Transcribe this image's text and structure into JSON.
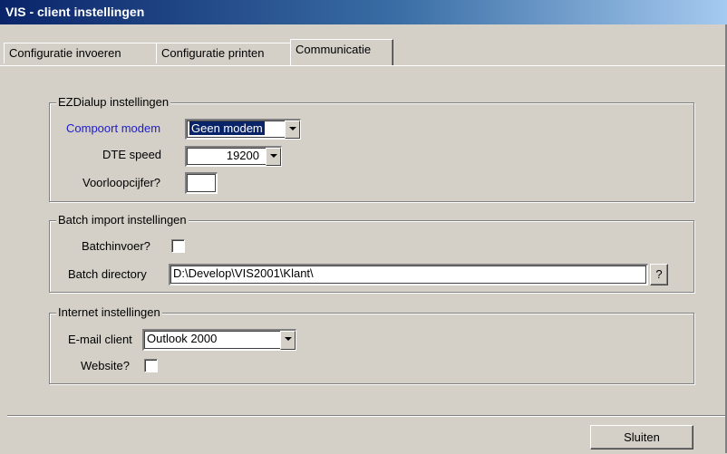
{
  "window": {
    "title": "VIS - client instellingen"
  },
  "tabs": [
    {
      "label": "Configuratie invoeren",
      "active": false
    },
    {
      "label": "Configuratie printen",
      "active": false
    },
    {
      "label": "Communicatie",
      "active": true
    }
  ],
  "ezdialup": {
    "title": "EZDialup instellingen",
    "compoort_label": "Compoort modem",
    "compoort_value": "Geen modem",
    "dte_label": "DTE speed",
    "dte_value": "19200",
    "voorloop_label": "Voorloopcijfer?",
    "voorloop_value": ""
  },
  "batch": {
    "title": "Batch import instellingen",
    "batchinvoer_label": "Batchinvoer?",
    "batchinvoer_checked": false,
    "directory_label": "Batch directory",
    "directory_value": "D:\\Develop\\VIS2001\\Klant\\",
    "browse_label": "?"
  },
  "internet": {
    "title": "Internet instellingen",
    "email_label": "E-mail client",
    "email_value": "Outlook 2000",
    "website_label": "Website?",
    "website_checked": false
  },
  "footer": {
    "close_label": "Sluiten"
  },
  "colors": {
    "titlebar_start": "#0a246a",
    "face": "#d4d0c8",
    "label_highlight": "#1c1ccc"
  }
}
